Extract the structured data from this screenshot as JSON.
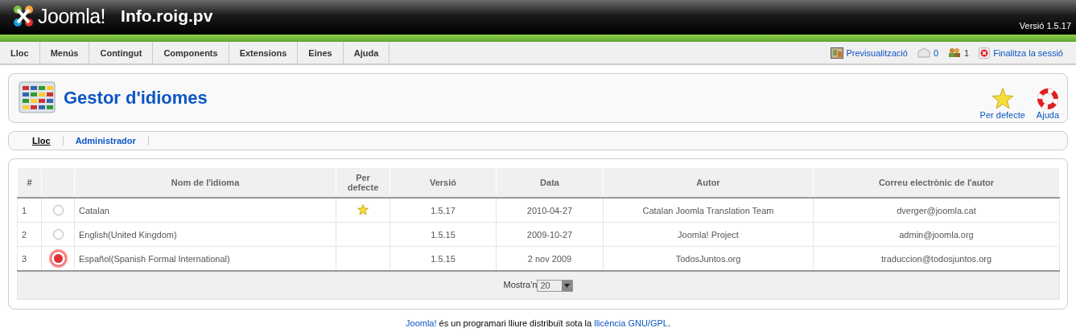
{
  "header": {
    "logo_text": "Joomla!",
    "site_name": "Info.roig.pv",
    "version": "Versió 1.5.17"
  },
  "menu": [
    {
      "label": "Lloc"
    },
    {
      "label": "Menús"
    },
    {
      "label": "Contingut"
    },
    {
      "label": "Components"
    },
    {
      "label": "Extensions"
    },
    {
      "label": "Eines"
    },
    {
      "label": "Ajuda"
    }
  ],
  "status": {
    "preview": "Previsualització",
    "messages": "0",
    "users": "1",
    "logout": "Finalitza la sessió"
  },
  "toolbar": {
    "title": "Gestor d'idiomes",
    "buttons": [
      {
        "kind": "default",
        "label": "Per defecte"
      },
      {
        "kind": "help",
        "label": "Ajuda"
      }
    ]
  },
  "subtabs": [
    {
      "label": "Lloc",
      "selected": true
    },
    {
      "label": "Administrador",
      "selected": false
    }
  ],
  "table": {
    "columns": [
      "#",
      "Nom de l'idioma",
      "Per defecte",
      "Versió",
      "Data",
      "Autor",
      "Correu electrònic de l'autor"
    ],
    "rows": [
      {
        "number": "1",
        "selected": false,
        "name": "Catalan",
        "default": true,
        "version": "1.5.17",
        "date": "2010-04-27",
        "author": "Catalan Joomla Translation Team",
        "email": "dverger@joomla.cat"
      },
      {
        "number": "2",
        "selected": false,
        "name": "English(United Kingdom)",
        "default": false,
        "version": "1.5.15",
        "date": "2009-10-27",
        "author": "Joomla! Project",
        "email": "admin@joomla.org"
      },
      {
        "number": "3",
        "selected": true,
        "name": "Español(Spanish Formal International)",
        "default": false,
        "version": "1.5.15",
        "date": "2 nov 2009",
        "author": "TodosJuntos.org",
        "email": "traduccion@todosjuntos.org"
      }
    ],
    "limit_label": "Mostra'n",
    "limit_value": "20"
  },
  "footer": {
    "link": "Joomla!",
    "text": " és un programari lliure distribuït sota la ",
    "license_link": "llicència GNU/GPL",
    "end": "."
  }
}
